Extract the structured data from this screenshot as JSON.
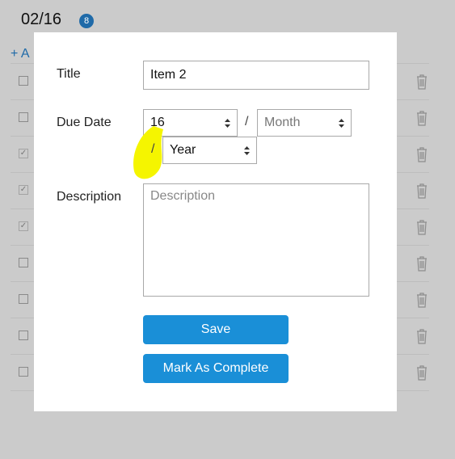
{
  "background": {
    "date_header": "02/16",
    "badge_count": "8",
    "add_label": "+ A",
    "rows": [
      {
        "checked": false
      },
      {
        "checked": false
      },
      {
        "checked": true
      },
      {
        "checked": true
      },
      {
        "checked": true
      },
      {
        "checked": false
      },
      {
        "checked": false
      },
      {
        "checked": false
      },
      {
        "checked": false
      }
    ]
  },
  "form": {
    "title_label": "Title",
    "title_value": "Item 2",
    "due_date_label": "Due Date",
    "day_value": "16",
    "slash": "/",
    "month_placeholder": "Month",
    "year_placeholder": "Year",
    "description_label": "Description",
    "description_placeholder": "Description",
    "save_label": "Save",
    "complete_label": "Mark As Complete"
  },
  "colors": {
    "accent": "#1a8fd7",
    "overlay": "#cbcbcb",
    "highlight": "#f5f500"
  }
}
